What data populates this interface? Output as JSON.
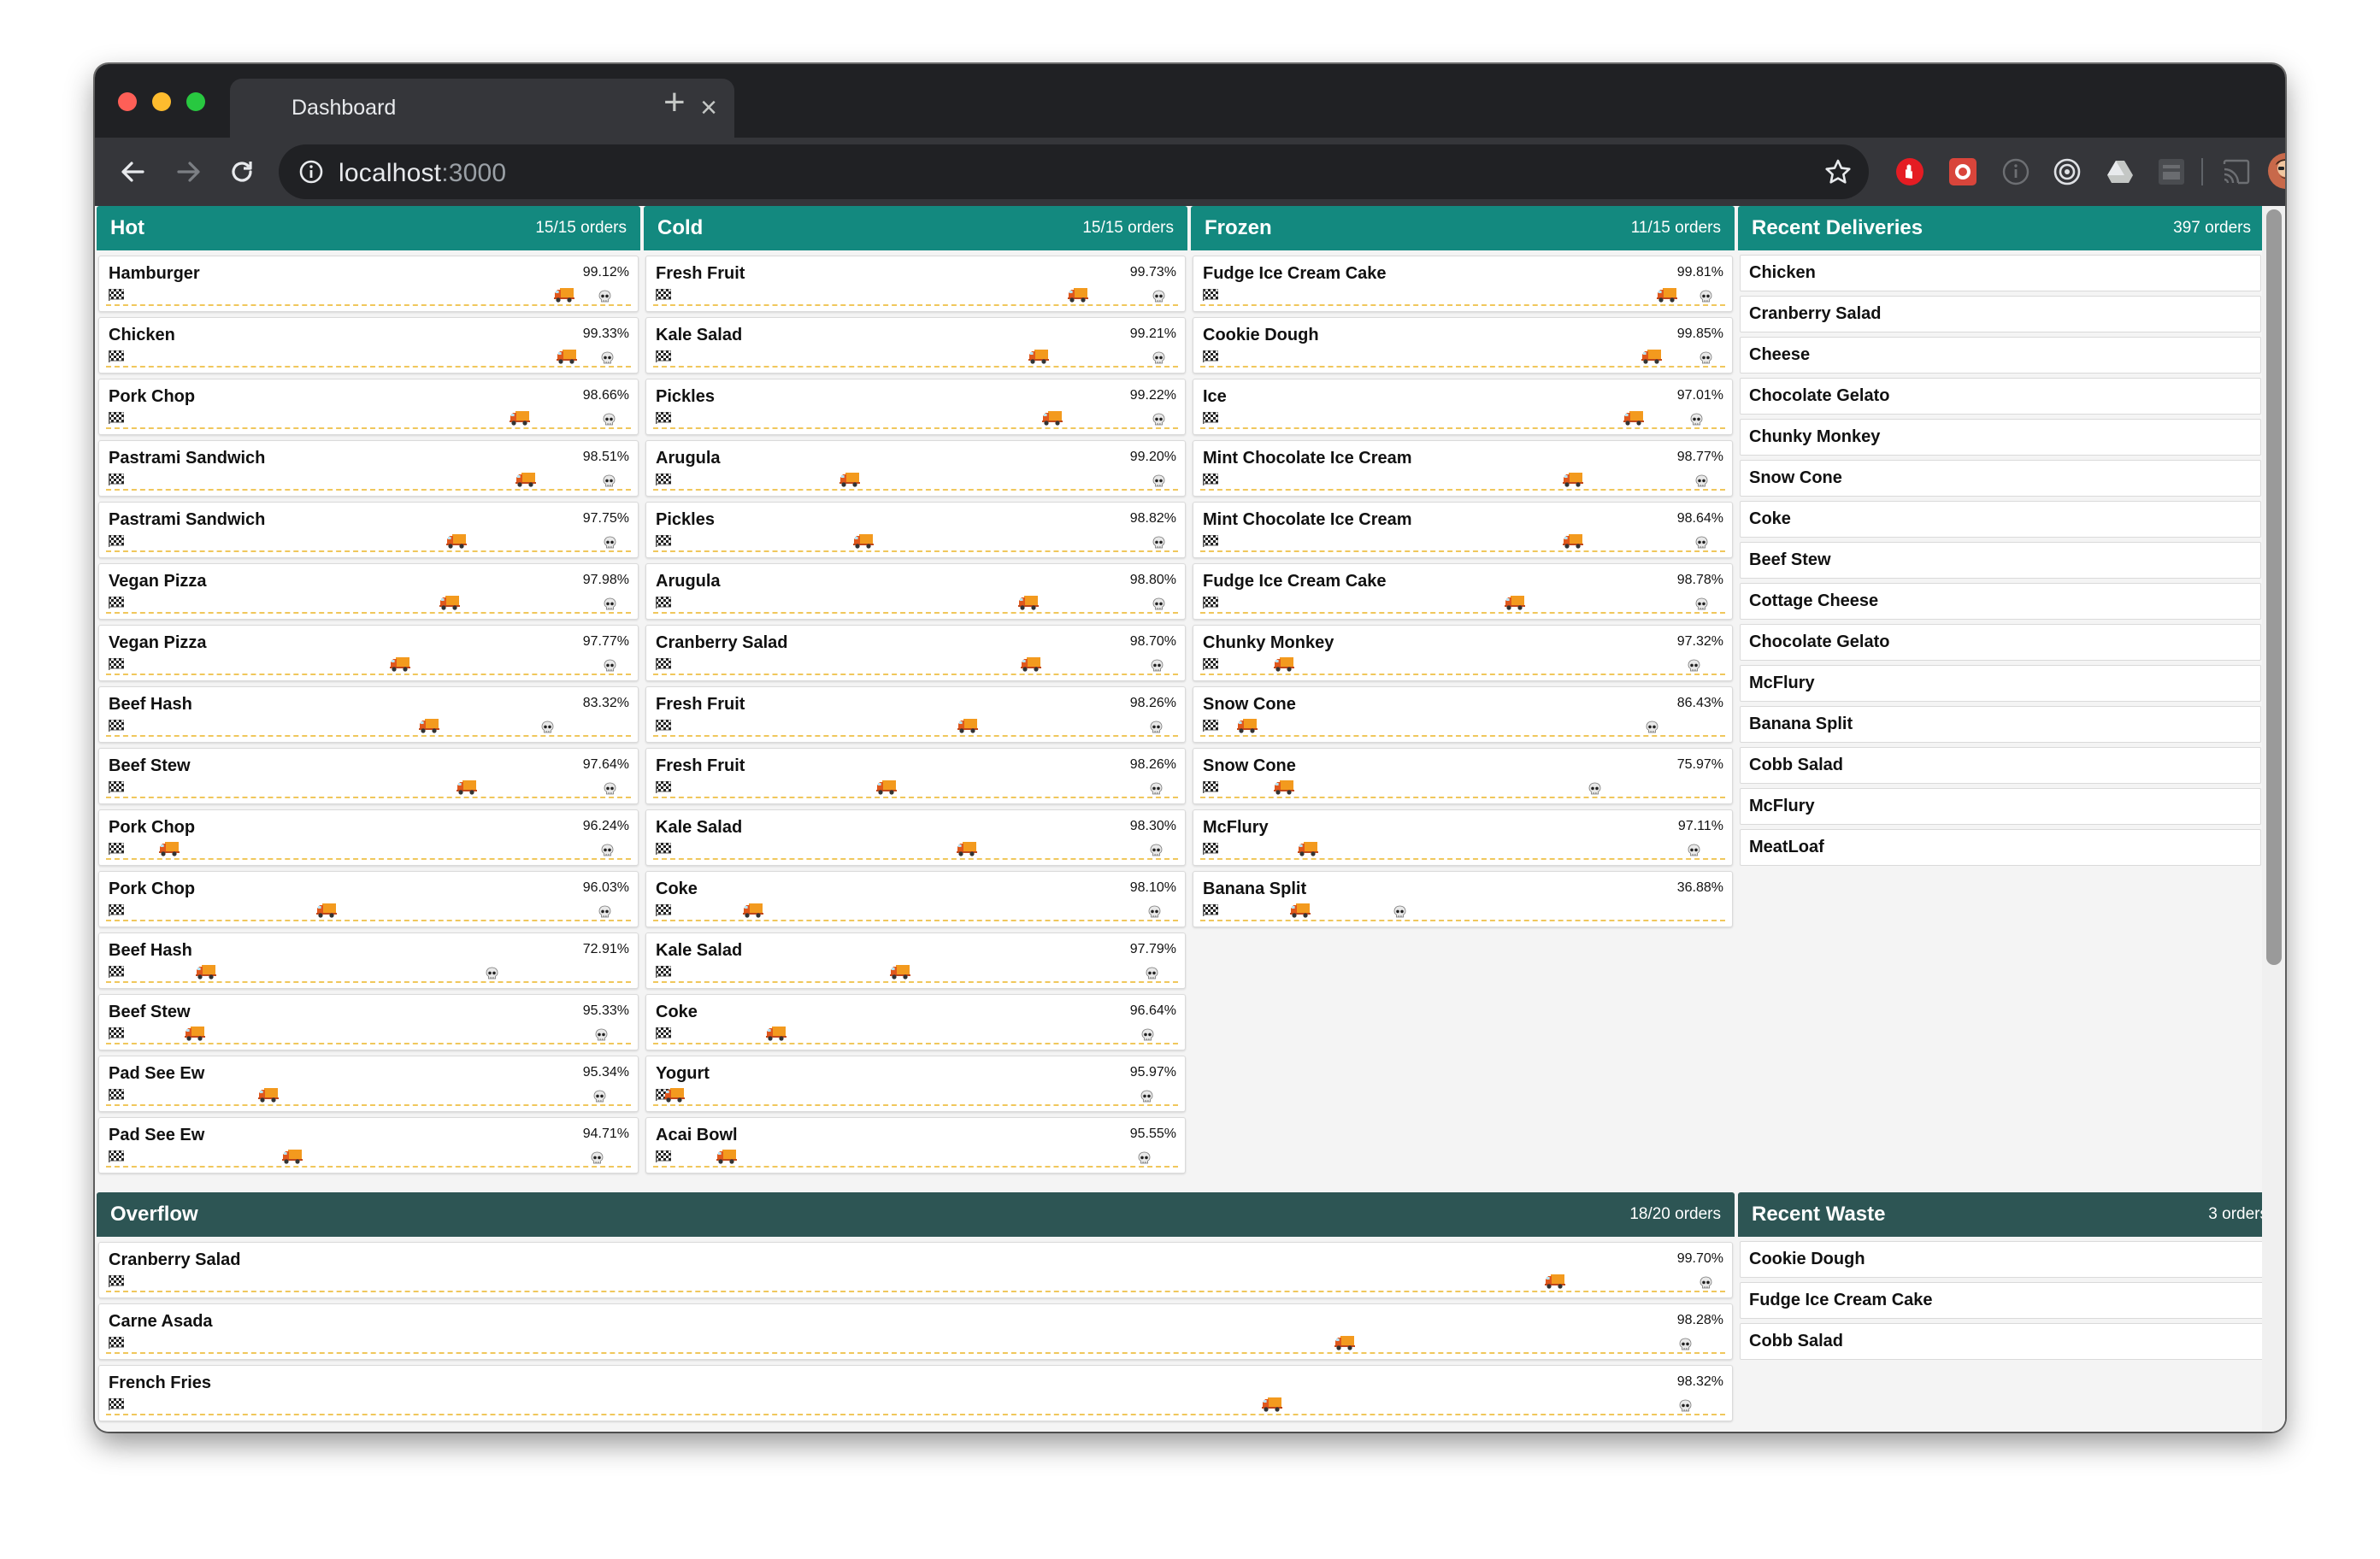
{
  "browser": {
    "tab_title": "Dashboard",
    "close_glyph": "×",
    "new_tab_glyph": "+",
    "url_host": "localhost",
    "url_port": ":3000",
    "icons": [
      "back-arrow-icon",
      "forward-arrow-icon",
      "reload-icon",
      "info-icon",
      "bookmark-star-icon",
      "extension-stop-icon",
      "extension-red-icon",
      "extension-info-icon",
      "extension-target-icon",
      "extension-drive-icon",
      "extension-box-icon",
      "cast-icon",
      "profile-avatar",
      "menu-kebab-icon"
    ]
  },
  "colors": {
    "panel_header": "#13897f",
    "overflow_header": "#2d5554",
    "track": "#f0c75c"
  },
  "order_icons": {
    "start": "checkered-flag-icon",
    "current": "delivery-truck-icon",
    "expiry": "skull-icon"
  },
  "panels": [
    {
      "title": "Hot",
      "count": "15/15 orders",
      "orders": [
        {
          "name": "Hamburger",
          "pct": "99.12%",
          "truck": 0.873,
          "skull": 0.95
        },
        {
          "name": "Chicken",
          "pct": "99.33%",
          "truck": 0.878,
          "skull": 0.955
        },
        {
          "name": "Pork Chop",
          "pct": "98.66%",
          "truck": 0.788,
          "skull": 0.957
        },
        {
          "name": "Pastrami Sandwich",
          "pct": "98.51%",
          "truck": 0.8,
          "skull": 0.957
        },
        {
          "name": "Pastrami Sandwich",
          "pct": "97.75%",
          "truck": 0.667,
          "skull": 0.96
        },
        {
          "name": "Vegan Pizza",
          "pct": "97.98%",
          "truck": 0.655,
          "skull": 0.96
        },
        {
          "name": "Vegan Pizza",
          "pct": "97.77%",
          "truck": 0.56,
          "skull": 0.96
        },
        {
          "name": "Beef Hash",
          "pct": "83.32%",
          "truck": 0.615,
          "skull": 0.84
        },
        {
          "name": "Beef Stew",
          "pct": "97.64%",
          "truck": 0.688,
          "skull": 0.96
        },
        {
          "name": "Pork Chop",
          "pct": "96.24%",
          "truck": 0.12,
          "skull": 0.955
        },
        {
          "name": "Pork Chop",
          "pct": "96.03%",
          "truck": 0.42,
          "skull": 0.95
        },
        {
          "name": "Beef Hash",
          "pct": "72.91%",
          "truck": 0.19,
          "skull": 0.735
        },
        {
          "name": "Beef Stew",
          "pct": "95.33%",
          "truck": 0.17,
          "skull": 0.943
        },
        {
          "name": "Pad See Ew",
          "pct": "95.34%",
          "truck": 0.31,
          "skull": 0.94
        },
        {
          "name": "Pad See Ew",
          "pct": "94.71%",
          "truck": 0.355,
          "skull": 0.935
        }
      ]
    },
    {
      "title": "Cold",
      "count": "15/15 orders",
      "orders": [
        {
          "name": "Fresh Fruit",
          "pct": "99.73%",
          "truck": 0.81,
          "skull": 0.963
        },
        {
          "name": "Kale Salad",
          "pct": "99.21%",
          "truck": 0.735,
          "skull": 0.963
        },
        {
          "name": "Pickles",
          "pct": "99.22%",
          "truck": 0.76,
          "skull": 0.963
        },
        {
          "name": "Arugula",
          "pct": "99.20%",
          "truck": 0.375,
          "skull": 0.963
        },
        {
          "name": "Pickles",
          "pct": "98.82%",
          "truck": 0.4,
          "skull": 0.962
        },
        {
          "name": "Arugula",
          "pct": "98.80%",
          "truck": 0.715,
          "skull": 0.962
        },
        {
          "name": "Cranberry Salad",
          "pct": "98.70%",
          "truck": 0.72,
          "skull": 0.96
        },
        {
          "name": "Fresh Fruit",
          "pct": "98.26%",
          "truck": 0.6,
          "skull": 0.957
        },
        {
          "name": "Fresh Fruit",
          "pct": "98.26%",
          "truck": 0.445,
          "skull": 0.957
        },
        {
          "name": "Kale Salad",
          "pct": "98.30%",
          "truck": 0.598,
          "skull": 0.957
        },
        {
          "name": "Coke",
          "pct": "98.10%",
          "truck": 0.19,
          "skull": 0.955
        },
        {
          "name": "Kale Salad",
          "pct": "97.79%",
          "truck": 0.47,
          "skull": 0.95
        },
        {
          "name": "Coke",
          "pct": "96.64%",
          "truck": 0.235,
          "skull": 0.942
        },
        {
          "name": "Yogurt",
          "pct": "95.97%",
          "truck": 0.04,
          "skull": 0.94
        },
        {
          "name": "Acai Bowl",
          "pct": "95.55%",
          "truck": 0.14,
          "skull": 0.935
        }
      ]
    },
    {
      "title": "Frozen",
      "count": "11/15 orders",
      "orders": [
        {
          "name": "Fudge Ice Cream Cake",
          "pct": "99.81%",
          "truck": 0.89,
          "skull": 0.963
        },
        {
          "name": "Cookie Dough",
          "pct": "99.85%",
          "truck": 0.86,
          "skull": 0.963
        },
        {
          "name": "Ice",
          "pct": "97.01%",
          "truck": 0.825,
          "skull": 0.945
        },
        {
          "name": "Mint Chocolate Ice Cream",
          "pct": "98.77%",
          "truck": 0.71,
          "skull": 0.955
        },
        {
          "name": "Mint Chocolate Ice Cream",
          "pct": "98.64%",
          "truck": 0.71,
          "skull": 0.955
        },
        {
          "name": "Fudge Ice Cream Cake",
          "pct": "98.78%",
          "truck": 0.6,
          "skull": 0.955
        },
        {
          "name": "Chunky Monkey",
          "pct": "97.32%",
          "truck": 0.16,
          "skull": 0.94
        },
        {
          "name": "Snow Cone",
          "pct": "86.43%",
          "truck": 0.09,
          "skull": 0.86
        },
        {
          "name": "Snow Cone",
          "pct": "75.97%",
          "truck": 0.16,
          "skull": 0.75
        },
        {
          "name": "McFlury",
          "pct": "97.11%",
          "truck": 0.205,
          "skull": 0.94
        },
        {
          "name": "Banana Split",
          "pct": "36.88%",
          "truck": 0.19,
          "skull": 0.38
        }
      ]
    }
  ],
  "recent_deliveries": {
    "title": "Recent Deliveries",
    "count": "397 orders",
    "items": [
      "Chicken",
      "Cranberry Salad",
      "Cheese",
      "Chocolate Gelato",
      "Chunky Monkey",
      "Snow Cone",
      "Coke",
      "Beef Stew",
      "Cottage Cheese",
      "Chocolate Gelato",
      "McFlury",
      "Banana Split",
      "Cobb Salad",
      "McFlury",
      "MeatLoaf"
    ]
  },
  "overflow": {
    "title": "Overflow",
    "count": "18/20 orders",
    "orders": [
      {
        "name": "Cranberry Salad",
        "pct": "99.70%",
        "truck": 0.895,
        "skull": 0.988
      },
      {
        "name": "Carne Asada",
        "pct": "98.28%",
        "truck": 0.765,
        "skull": 0.975
      },
      {
        "name": "French Fries",
        "pct": "98.32%",
        "truck": 0.72,
        "skull": 0.975
      }
    ]
  },
  "recent_waste": {
    "title": "Recent Waste",
    "count": "3 orders",
    "items": [
      "Cookie Dough",
      "Fudge Ice Cream Cake",
      "Cobb Salad"
    ]
  }
}
